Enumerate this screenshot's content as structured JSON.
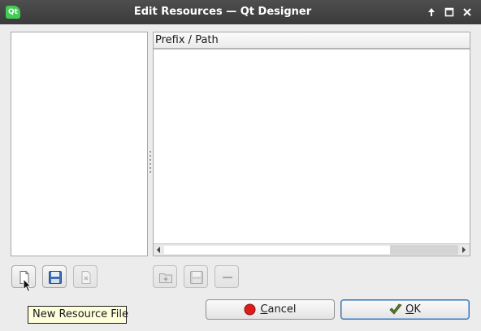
{
  "window": {
    "title": "Edit Resources — Qt Designer",
    "app_icon_text": "Qt",
    "controls": [
      "arrow-up-icon",
      "maximize-icon",
      "close-icon"
    ]
  },
  "tree": {
    "header": "Prefix / Path"
  },
  "file_toolbar": [
    {
      "name": "new-resource-file-button",
      "icon": "new-file-icon",
      "enabled": true
    },
    {
      "name": "open-resource-file-button",
      "icon": "save-floppy-icon",
      "enabled": true
    },
    {
      "name": "remove-resource-file-button",
      "icon": "remove-file-icon",
      "enabled": false
    }
  ],
  "resource_toolbar": [
    {
      "name": "add-prefix-button",
      "icon": "add-folder-icon",
      "enabled": false
    },
    {
      "name": "add-files-button",
      "icon": "save-floppy-icon",
      "enabled": false
    },
    {
      "name": "remove-button",
      "icon": "minus-icon",
      "enabled": false
    }
  ],
  "tooltip": {
    "text": "New Resource File"
  },
  "buttons": {
    "cancel": {
      "mnemonic": "C",
      "rest": "ancel"
    },
    "ok": {
      "mnemonic": "O",
      "rest": "K"
    }
  },
  "colors": {
    "titlebar": "#3f3f3f",
    "tooltip_bg": "#ffffdc",
    "cancel_icon": "#e01b1b",
    "ok_icon": "#5a7a2e"
  }
}
